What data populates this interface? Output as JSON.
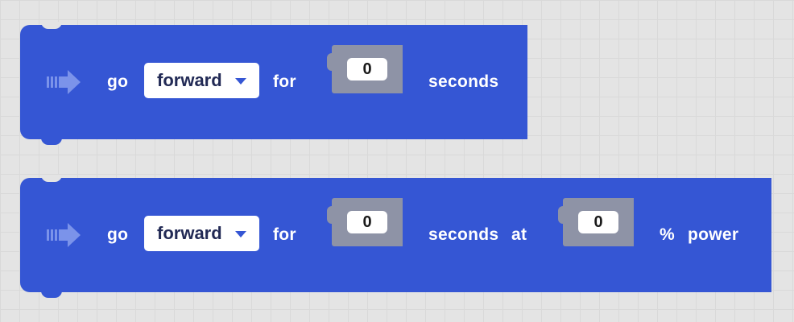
{
  "workspace": {
    "background_color": "#e4e4e4",
    "block_color": "#3556d4",
    "socket_color": "#8e93a6"
  },
  "blocks": [
    {
      "icon": "drive-arrow-icon",
      "go_label": "go",
      "direction": {
        "selected": "forward",
        "icon": "caret-down-icon"
      },
      "for_label": "for",
      "seconds": {
        "value": "0"
      },
      "seconds_label": "seconds"
    },
    {
      "icon": "drive-arrow-icon",
      "go_label": "go",
      "direction": {
        "selected": "forward",
        "icon": "caret-down-icon"
      },
      "for_label": "for",
      "seconds": {
        "value": "0"
      },
      "seconds_label": "seconds",
      "at_label": "at",
      "power": {
        "value": "0"
      },
      "percent_label": "%",
      "power_label": "power"
    }
  ]
}
